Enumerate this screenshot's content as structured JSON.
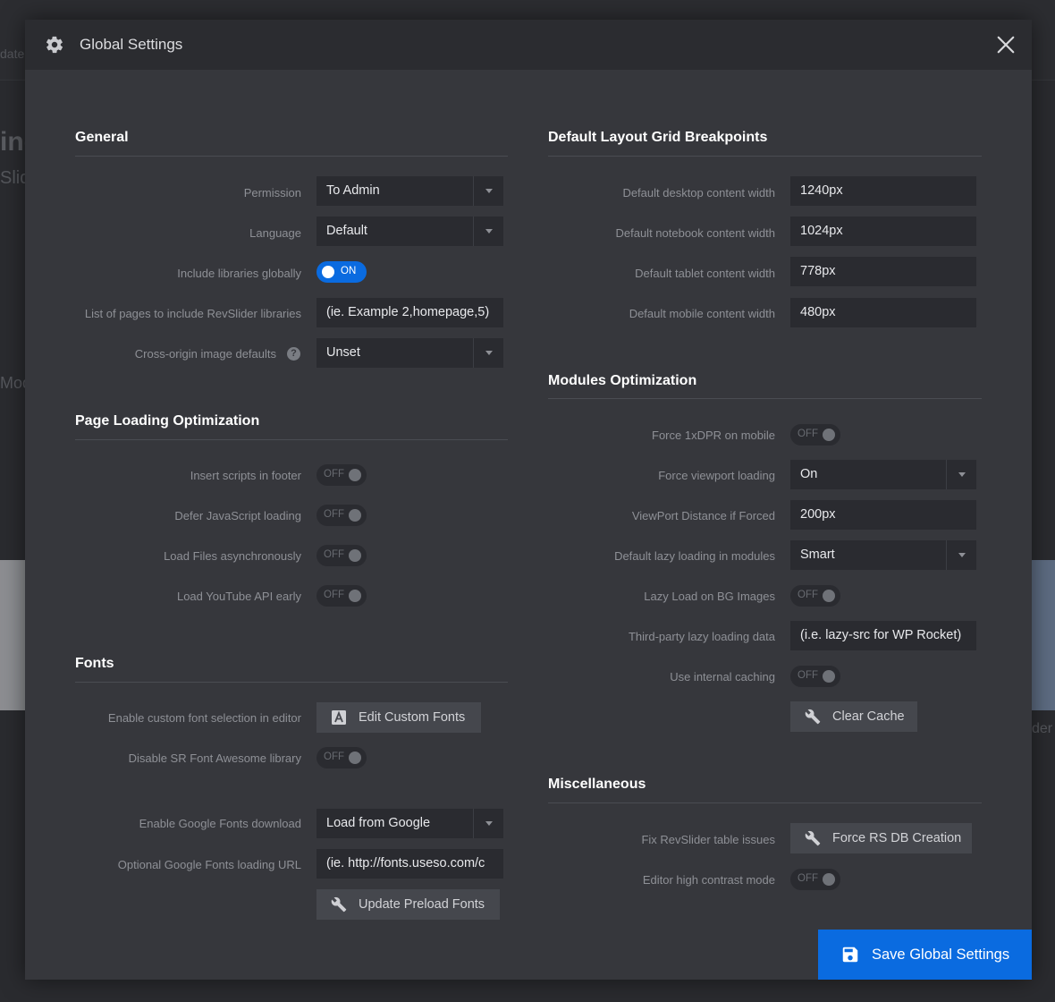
{
  "header": {
    "title": "Global Settings"
  },
  "general": {
    "title": "General",
    "permission": {
      "label": "Permission",
      "value": "To Admin"
    },
    "language": {
      "label": "Language",
      "value": "Default"
    },
    "include_libraries": {
      "label": "Include libraries globally",
      "state": "ON"
    },
    "pages_list": {
      "label": "List of pages to include RevSlider libraries",
      "placeholder": "(ie. Example 2,homepage,5)"
    },
    "cross_origin": {
      "label": "Cross-origin image defaults",
      "value": "Unset",
      "help": "?"
    }
  },
  "page_loading": {
    "title": "Page Loading Optimization",
    "items": [
      {
        "label": "Insert scripts in footer",
        "state": "OFF"
      },
      {
        "label": "Defer JavaScript loading",
        "state": "OFF"
      },
      {
        "label": "Load Files asynchronously",
        "state": "OFF"
      },
      {
        "label": "Load YouTube API early",
        "state": "OFF"
      }
    ]
  },
  "fonts": {
    "title": "Fonts",
    "custom_font": {
      "label": "Enable custom font selection in editor",
      "button": "Edit Custom Fonts"
    },
    "font_awesome": {
      "label": "Disable SR Font Awesome library",
      "state": "OFF"
    },
    "google_download": {
      "label": "Enable Google Fonts download",
      "value": "Load from Google"
    },
    "google_url": {
      "label": "Optional Google Fonts loading URL",
      "placeholder": "(ie. http://fonts.useso.com/c"
    },
    "preload_button": "Update Preload Fonts"
  },
  "breakpoints": {
    "title": "Default Layout Grid Breakpoints",
    "items": [
      {
        "label": "Default desktop content width",
        "value": "1240px"
      },
      {
        "label": "Default notebook content width",
        "value": "1024px"
      },
      {
        "label": "Default tablet content width",
        "value": "778px"
      },
      {
        "label": "Default mobile content width",
        "value": "480px"
      }
    ]
  },
  "modules": {
    "title": "Modules Optimization",
    "force_dpr": {
      "label": "Force 1xDPR on mobile",
      "state": "OFF"
    },
    "viewport_loading": {
      "label": "Force viewport loading",
      "value": "On"
    },
    "viewport_distance": {
      "label": "ViewPort Distance if Forced",
      "value": "200px"
    },
    "lazy_loading": {
      "label": "Default lazy loading in modules",
      "value": "Smart"
    },
    "lazy_bg": {
      "label": "Lazy Load on BG Images",
      "state": "OFF"
    },
    "third_party": {
      "label": "Third-party lazy loading data",
      "placeholder": "(i.e. lazy-src for WP Rocket)"
    },
    "internal_caching": {
      "label": "Use internal caching",
      "state": "OFF"
    },
    "clear_cache": "Clear Cache"
  },
  "misc": {
    "title": "Miscellaneous",
    "fix_table": {
      "label": "Fix RevSlider table issues",
      "button": "Force RS DB Creation"
    },
    "high_contrast": {
      "label": "Editor high contrast mode",
      "state": "OFF"
    }
  },
  "footer": {
    "save_label": "Save Global Settings"
  },
  "colors": {
    "accent": "#0a6be0",
    "modal_bg": "#36373c",
    "header_bg": "#2b2c30",
    "input_bg": "#2a2b30"
  },
  "icons": {
    "header": "gear-icon",
    "close": "close-icon",
    "fonts": "font-a-icon",
    "tools": "wrench-icon",
    "save": "floppy-disk-icon"
  }
}
